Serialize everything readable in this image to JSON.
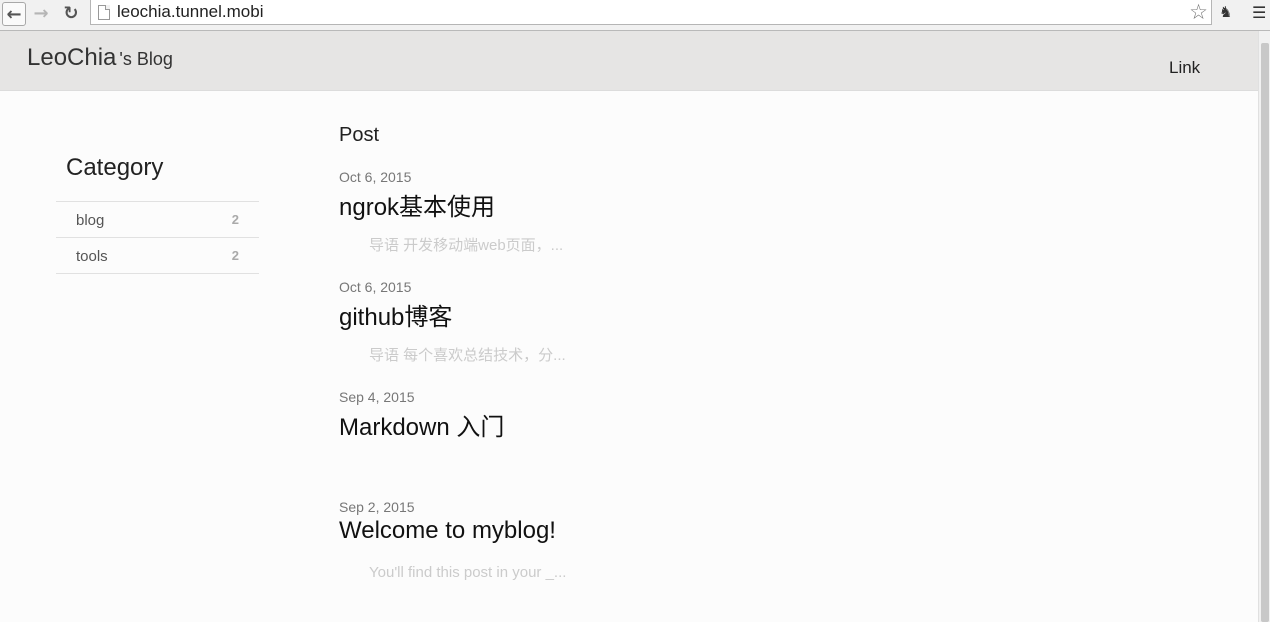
{
  "browser": {
    "url": "leochia.tunnel.mobi"
  },
  "site": {
    "brand_name": "LeoChia",
    "brand_suffix": "'s Blog",
    "nav_link": "Link"
  },
  "sidebar": {
    "title": "Category",
    "items": [
      {
        "label": "blog",
        "count": "2"
      },
      {
        "label": "tools",
        "count": "2"
      }
    ]
  },
  "posts": {
    "heading": "Post",
    "items": [
      {
        "date": "Oct 6, 2015",
        "title": "ngrok基本使用",
        "excerpt": "导语 开发移动端web页面，..."
      },
      {
        "date": "Oct 6, 2015",
        "title": "github博客",
        "excerpt": "导语 每个喜欢总结技术，分..."
      },
      {
        "date": "Sep 4, 2015",
        "title": "Markdown 入门",
        "excerpt": ""
      },
      {
        "date": "Sep 2, 2015",
        "title": "Welcome to myblog!",
        "excerpt": "You'll find this post in your _..."
      }
    ]
  }
}
